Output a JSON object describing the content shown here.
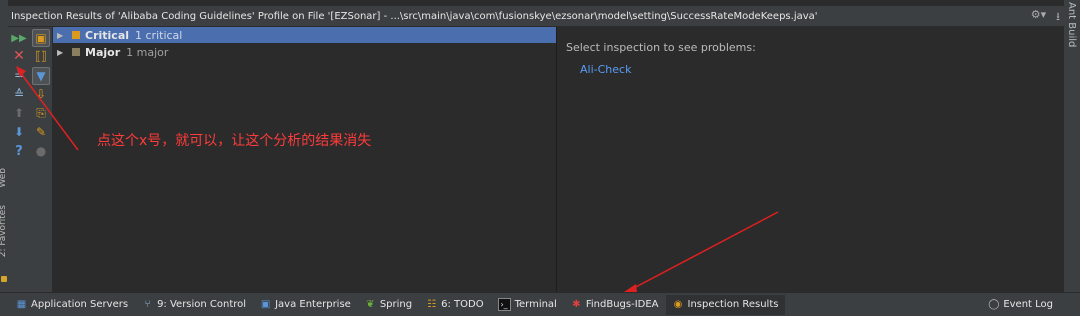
{
  "window": {
    "title": "Inspection Results of 'Alibaba Coding Guidelines' Profile on File '[EZSonar] - ...\\src\\main\\java\\com\\fusionskye\\ezsonar\\model\\setting\\SuccessRateModeKeeps.java'"
  },
  "side_panels": {
    "left_label_1": "2: Favorites",
    "left_label_2": "Web",
    "right_label": "Ant Build"
  },
  "tree": {
    "items": [
      {
        "label": "Critical",
        "count": "1 critical",
        "color": "#d99a1f",
        "selected": true
      },
      {
        "label": "Major",
        "count": "1 major",
        "color": "#8a7f5e",
        "selected": false
      }
    ]
  },
  "detail": {
    "prompt": "Select inspection to see problems:",
    "link": "Ali-Check"
  },
  "annotation": {
    "text": "点这个x号，就可以，让这个分析的结果消失",
    "color": "#ff3b3b"
  },
  "statusbar": {
    "tabs": [
      {
        "label": "Application Servers",
        "icon": "server-icon",
        "active": false
      },
      {
        "label": "9: Version Control",
        "icon": "vcs-icon",
        "active": false
      },
      {
        "label": "Java Enterprise",
        "icon": "java-ee-icon",
        "active": false
      },
      {
        "label": "Spring",
        "icon": "spring-leaf-icon",
        "active": false
      },
      {
        "label": "6: TODO",
        "icon": "todo-icon",
        "active": false
      },
      {
        "label": "Terminal",
        "icon": "terminal-icon",
        "active": false
      },
      {
        "label": "FindBugs-IDEA",
        "icon": "bug-icon",
        "active": false
      },
      {
        "label": "Inspection Results",
        "icon": "inspection-icon",
        "active": true
      }
    ],
    "event_log": "Event Log"
  },
  "colors": {
    "selection": "#4b6eaf",
    "link": "#589df6",
    "panel": "#3c3f41",
    "background": "#2b2b2b"
  }
}
